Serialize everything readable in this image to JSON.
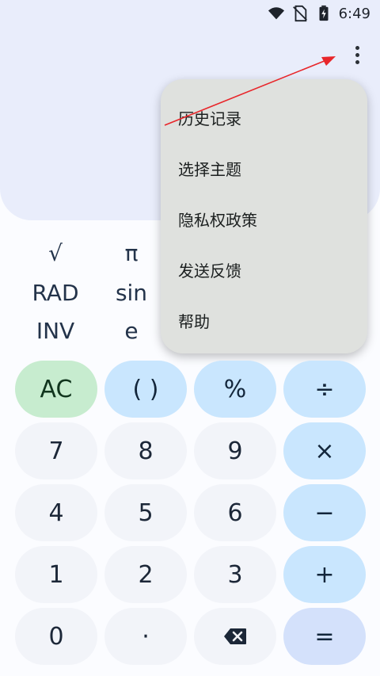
{
  "status": {
    "time": "6:49",
    "icons": [
      "wifi-icon",
      "no-sim-icon",
      "battery-charging-icon"
    ]
  },
  "toolbar": {
    "overflow_icon": "more-vert-icon"
  },
  "scientific": {
    "row1": [
      "√",
      "π"
    ],
    "row2": [
      "RAD",
      "sin"
    ],
    "row3": [
      "INV",
      "e"
    ]
  },
  "menu": {
    "items": [
      "历史记录",
      "选择主题",
      "隐私权政策",
      "发送反馈",
      "帮助"
    ]
  },
  "keypad": {
    "rows": [
      [
        "AC",
        "( )",
        "%",
        "÷"
      ],
      [
        "7",
        "8",
        "9",
        "×"
      ],
      [
        "4",
        "5",
        "6",
        "−"
      ],
      [
        "1",
        "2",
        "3",
        "+"
      ],
      [
        "0",
        "·",
        "backspace-icon",
        "="
      ]
    ]
  },
  "colors": {
    "display_bg": "#e9edfb",
    "menu_bg": "#dfe1de",
    "operator_key": "#c9e6fe",
    "clear_key": "#c7eccf",
    "equals_key": "#d4e1fb",
    "number_key": "#f2f4f9",
    "annotation_arrow": "#e8262a"
  }
}
